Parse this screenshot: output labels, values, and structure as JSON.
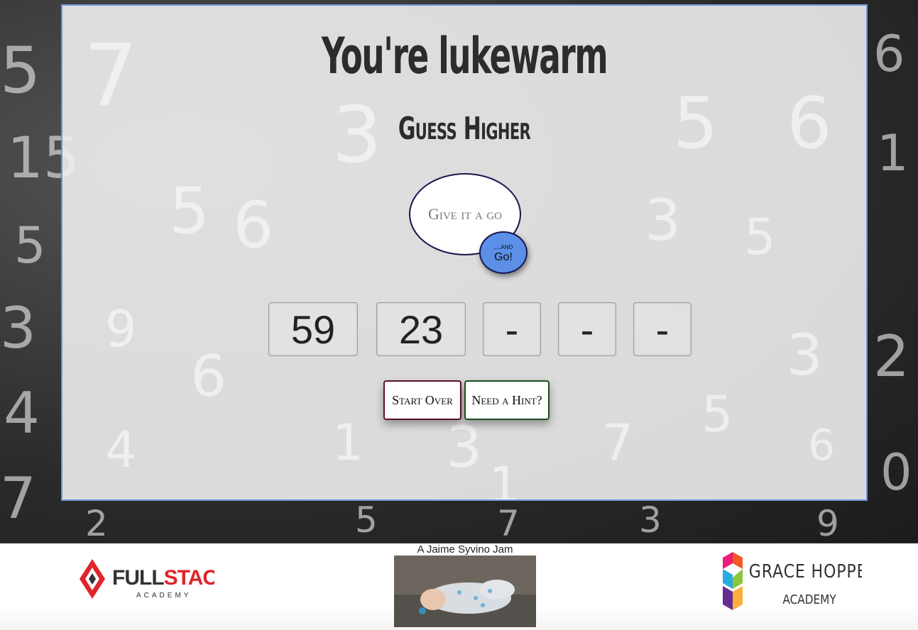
{
  "game": {
    "title": "You're lukewarm",
    "subtitle": "Guess Higher",
    "guess_placeholder": "Give it a go",
    "go_small": "...and",
    "go_big": "Go!",
    "guesses": [
      "59",
      "23",
      "-",
      "-",
      "-"
    ]
  },
  "buttons": {
    "start_over": "Start Over",
    "hint": "Need a Hint?"
  },
  "footer": {
    "credit": "A Jaime Syvino Jam",
    "fullstack_logo_text": "FULLSTACK",
    "fullstack_logo_sub": "ACADEMY",
    "gracehopper_logo_text": "GRACE HOPPER",
    "gracehopper_logo_sub": "ACADEMY"
  },
  "colors": {
    "panel_border": "#6e95d6",
    "go_button": "#5b8fe8",
    "start_border": "#5a1220",
    "hint_border": "#1d4a1d",
    "fullstack_red": "#e0242b"
  }
}
